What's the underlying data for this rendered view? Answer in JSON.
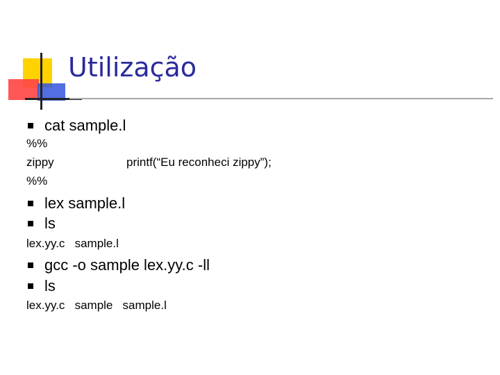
{
  "title": "Utilização",
  "colors": {
    "title": "#2a2a9c",
    "logo_yellow": "#ffd200",
    "logo_red": "#ff4444",
    "logo_blue": "#3355dd"
  },
  "bullet_icon": "square-bullet-icon",
  "lines": {
    "bullet1": "cat sample.l",
    "pct1": "%%",
    "zippy": "zippy",
    "printf": "printf(“Eu reconheci zippy”);",
    "pct2": "%%",
    "bullet2": "lex sample.l",
    "bullet3": "ls",
    "output1": "lex.yy.c   sample.l",
    "bullet4": "gcc -o sample lex.yy.c -ll",
    "bullet5": "ls",
    "output2": "lex.yy.c   sample   sample.l"
  }
}
